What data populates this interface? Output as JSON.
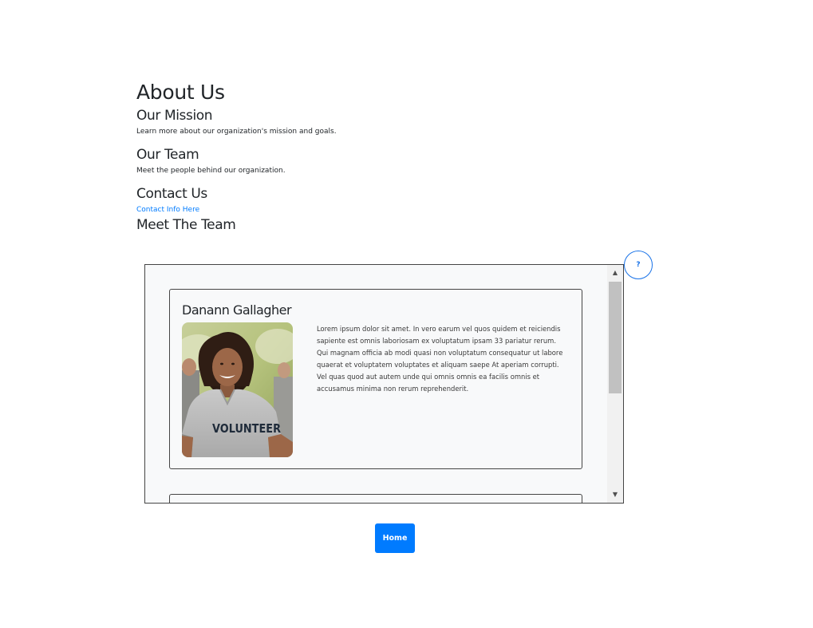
{
  "page": {
    "title": "About Us"
  },
  "sections": {
    "mission": {
      "heading": "Our Mission",
      "text": "Learn more about our organization's mission and goals."
    },
    "team": {
      "heading": "Our Team",
      "text": "Meet the people behind our organization."
    },
    "contact": {
      "heading": "Contact Us",
      "link_text": "Contact Info Here"
    },
    "meet_team": {
      "heading": "Meet The Team"
    }
  },
  "members": [
    {
      "name": "Danann Gallagher",
      "photo_shirt_text": "VOLUNTEER",
      "bio": "Lorem ipsum dolor sit amet. In vero earum vel quos quidem et reiciendis sapiente est omnis laboriosam ex voluptatum ipsam 33 pariatur rerum. Qui magnam officia ab modi quasi non voluptatum consequatur ut labore quaerat et voluptatem voluptates et aliquam saepe At aperiam corrupti. Vel quas quod aut autem unde qui omnis omnis ea facilis omnis et accusamus minima non rerum reprehenderit."
    }
  ],
  "help_button": {
    "label": "?"
  },
  "home_button": {
    "label": "Home"
  },
  "colors": {
    "primary": "#007bff",
    "help_accent": "#1a73e8",
    "card_background": "#f8f9fa",
    "border": "#454545"
  },
  "icons": {
    "scroll_up": "triangle-up-icon",
    "scroll_down": "triangle-down-icon"
  }
}
